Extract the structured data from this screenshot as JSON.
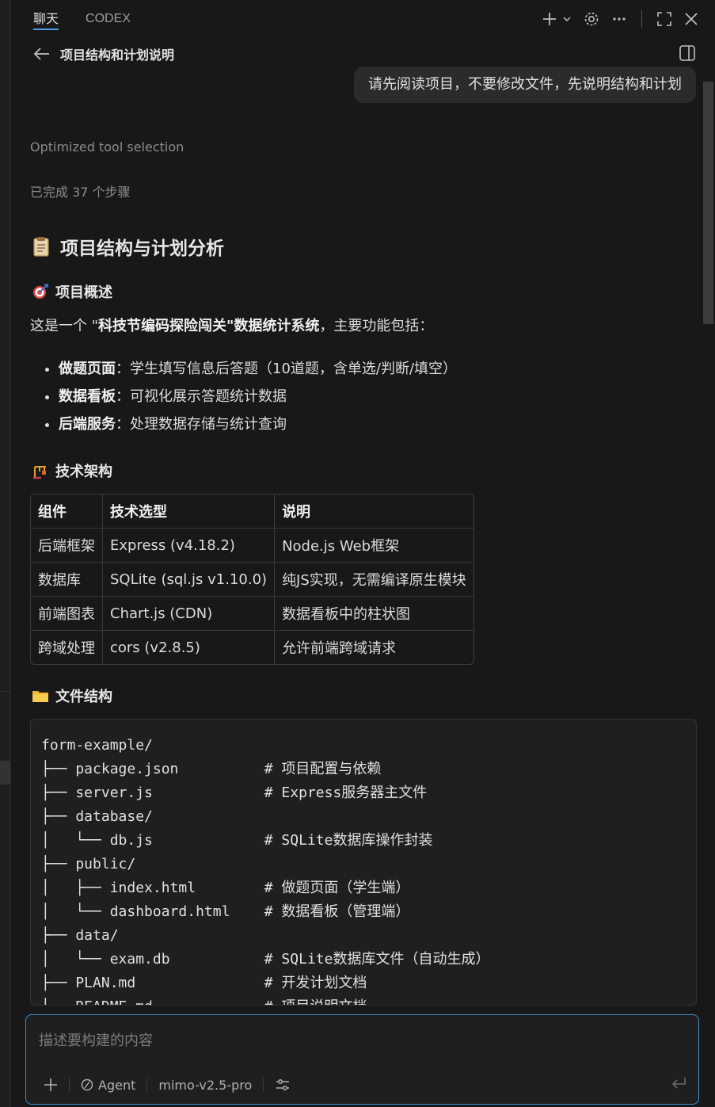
{
  "header": {
    "tabs": [
      {
        "label": "聊天"
      },
      {
        "label": "CODEX"
      }
    ]
  },
  "conversation": {
    "title": "项目结构和计划说明",
    "user_message": "请先阅读项目，不要修改文件，先说明结构和计划",
    "status_tool": "Optimized tool selection",
    "status_steps_prefix": "已完成 ",
    "status_steps_count": "37",
    "status_steps_suffix": " 个步骤"
  },
  "answer": {
    "heading": "项目结构与计划分析",
    "overview_heading": "项目概述",
    "intro_prefix": "这是一个 \"",
    "intro_bold": "科技节编码探险闯关\"数据统计系统",
    "intro_suffix": "，主要功能包括：",
    "features": [
      {
        "name": "做题页面",
        "desc": "：学生填写信息后答题（10道题，含单选/判断/填空）"
      },
      {
        "name": "数据看板",
        "desc": "：可视化展示答题统计数据"
      },
      {
        "name": "后端服务",
        "desc": "：处理数据存储与统计查询"
      }
    ],
    "arch_heading": "技术架构",
    "table": {
      "headers": [
        "组件",
        "技术选型",
        "说明"
      ],
      "rows": [
        [
          "后端框架",
          "Express (v4.18.2)",
          "Node.js Web框架"
        ],
        [
          "数据库",
          "SQLite (sql.js v1.10.0)",
          "纯JS实现，无需编译原生模块"
        ],
        [
          "前端图表",
          "Chart.js (CDN)",
          "数据看板中的柱状图"
        ],
        [
          "跨域处理",
          "cors (v2.8.5)",
          "允许前端跨域请求"
        ]
      ]
    },
    "files_heading": "文件结构",
    "file_tree": [
      "form-example/",
      "├── package.json          # 项目配置与依赖",
      "├── server.js             # Express服务器主文件",
      "├── database/",
      "│   └── db.js             # SQLite数据库操作封装",
      "├── public/",
      "│   ├── index.html        # 做题页面（学生端）",
      "│   └── dashboard.html    # 数据看板（管理端）",
      "├── data/",
      "│   └── exam.db           # SQLite数据库文件（自动生成）",
      "├── PLAN.md               # 开发计划文档",
      "└── README.md             # 项目说明文档"
    ]
  },
  "input": {
    "placeholder": "描述要构建的内容",
    "mode_label": "Agent",
    "model_label": "mimo-v2.5-pro"
  },
  "colors": {
    "accent": "#4d9eed",
    "focus_border": "#3f8ecf",
    "background": "#181818"
  }
}
